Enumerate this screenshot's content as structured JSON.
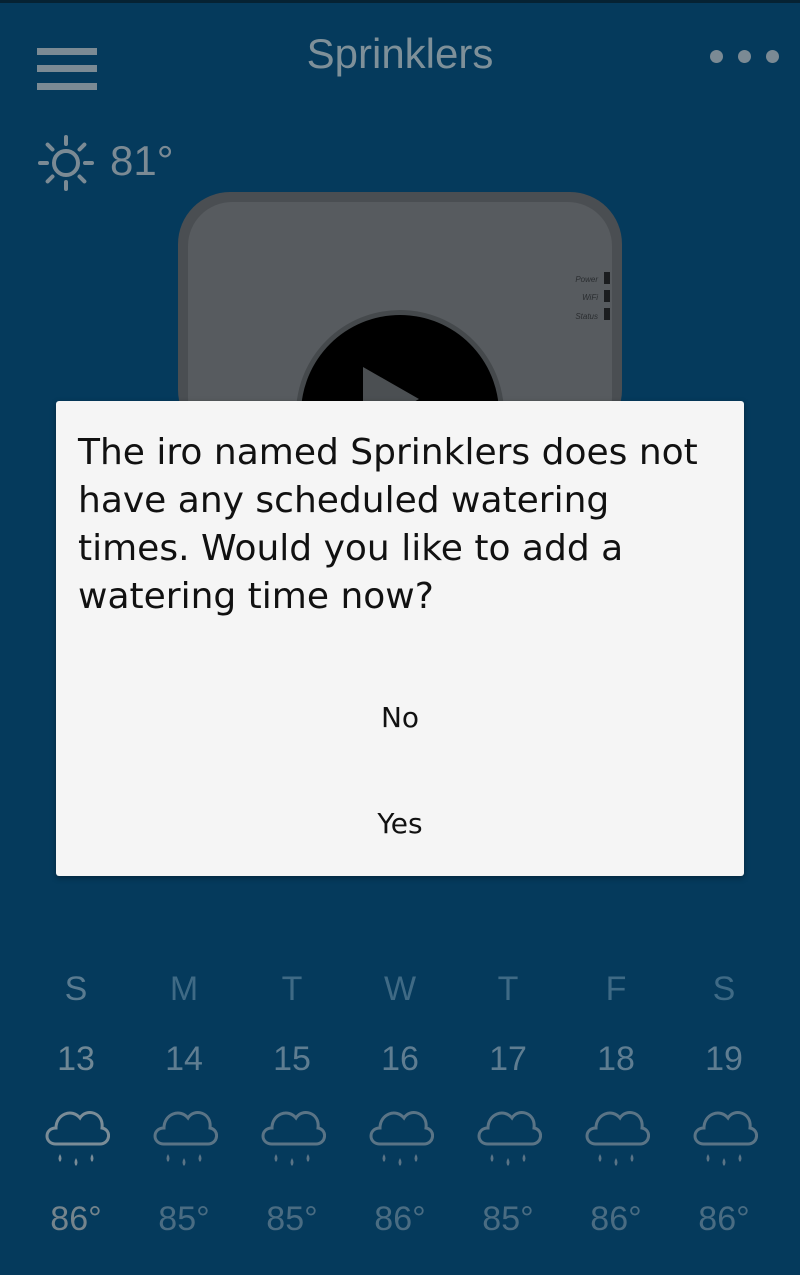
{
  "header": {
    "title": "Sprinklers",
    "menu_icon": "hamburger-menu-icon",
    "more_icon": "more-dots-icon"
  },
  "current_weather": {
    "icon": "sun-icon",
    "temperature": "81°"
  },
  "device": {
    "indicators": [
      "Power",
      "WiFi",
      "Status"
    ],
    "play_icon": "play-icon"
  },
  "dialog": {
    "message": "The iro named Sprinklers does not have any scheduled watering times. Would you like to add a watering time now?",
    "no_label": "No",
    "yes_label": "Yes"
  },
  "forecast": [
    {
      "day": "S",
      "date": "13",
      "icon": "rain-cloud-icon",
      "temp": "86°"
    },
    {
      "day": "M",
      "date": "14",
      "icon": "rain-cloud-icon",
      "temp": "85°"
    },
    {
      "day": "T",
      "date": "15",
      "icon": "rain-cloud-icon",
      "temp": "85°"
    },
    {
      "day": "W",
      "date": "16",
      "icon": "rain-cloud-icon",
      "temp": "86°"
    },
    {
      "day": "T",
      "date": "17",
      "icon": "rain-cloud-icon",
      "temp": "85°"
    },
    {
      "day": "F",
      "date": "18",
      "icon": "rain-cloud-icon",
      "temp": "86°"
    },
    {
      "day": "S",
      "date": "19",
      "icon": "rain-cloud-icon",
      "temp": "86°"
    }
  ],
  "colors": {
    "background": "#053a5c",
    "dialog_background": "#f5f5f5",
    "header_text": "#7e9099"
  }
}
